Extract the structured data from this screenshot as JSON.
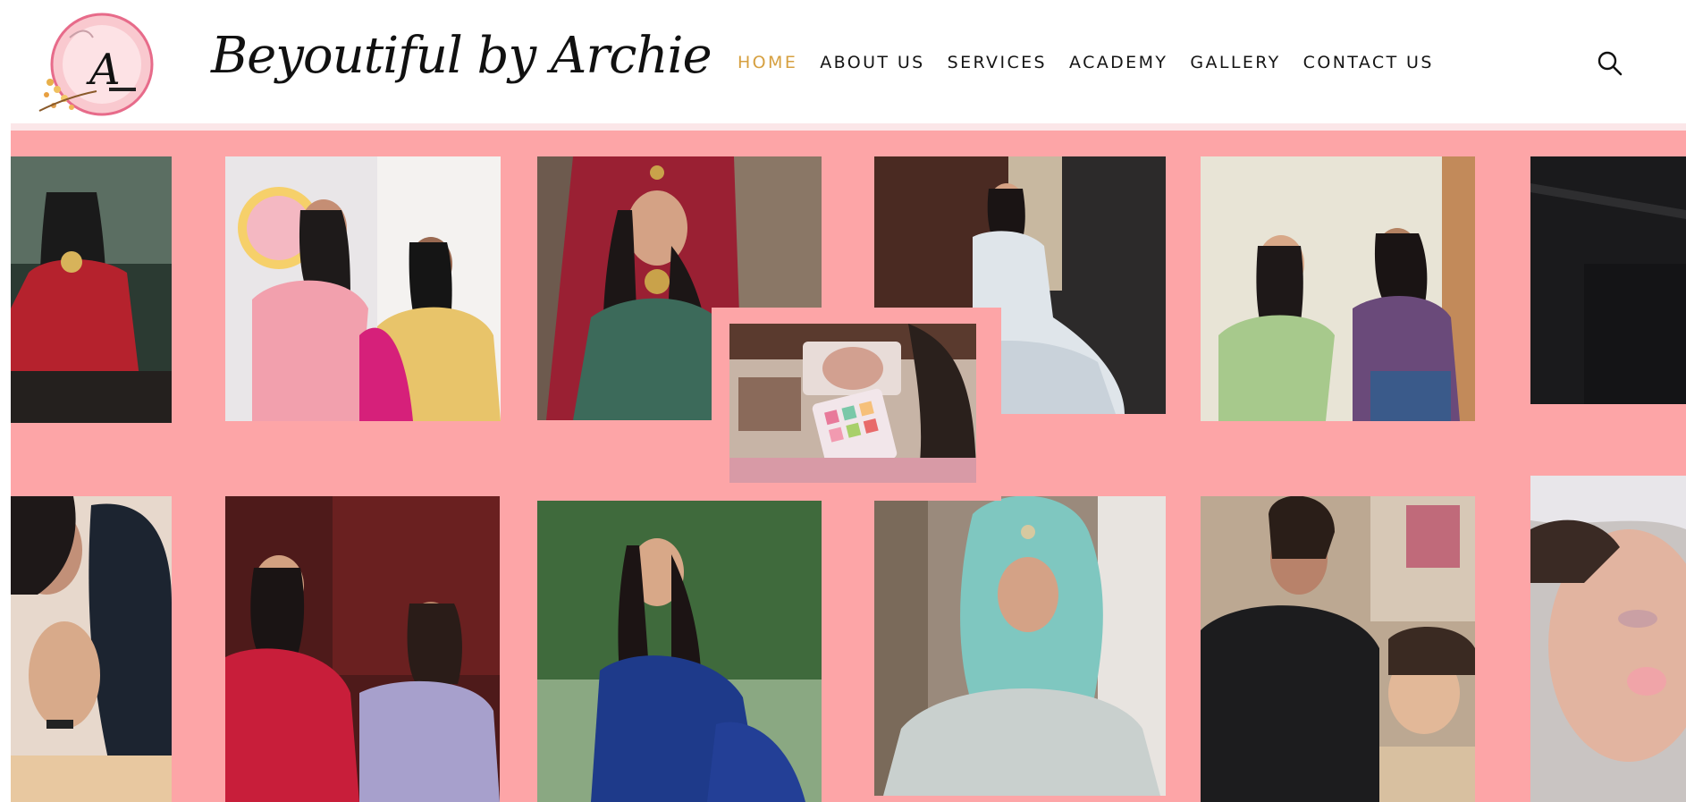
{
  "header": {
    "brand": "Beyoutiful by Archie",
    "logo_letter": "A",
    "logo_icon": "brand-logo-icon",
    "nav": [
      {
        "label": "HOME",
        "active": true
      },
      {
        "label": "ABOUT US",
        "active": false
      },
      {
        "label": "SERVICES",
        "active": false
      },
      {
        "label": "ACADEMY",
        "active": false
      },
      {
        "label": "GALLERY",
        "active": false
      },
      {
        "label": "CONTACT US",
        "active": false
      }
    ],
    "search_icon": "search-icon"
  },
  "colors": {
    "accent": "#d6a040",
    "gallery_bg": "#fda5a7",
    "nav_text": "#151515"
  },
  "gallery": {
    "photos": [
      "bride-red-lehenga",
      "artist-pink-with-bride",
      "bride-maroon-dupatta",
      "bride-white-gown",
      "artist-applying-makeup-green-saree",
      "dark-photo-right",
      "artist-ear-detail",
      "artist-with-bride-red",
      "eyeshadow-palette-mirror",
      "bride-blue-gown",
      "bride-teal-hijab",
      "artist-applying-eye-makeup",
      "closeup-face-glow"
    ]
  }
}
